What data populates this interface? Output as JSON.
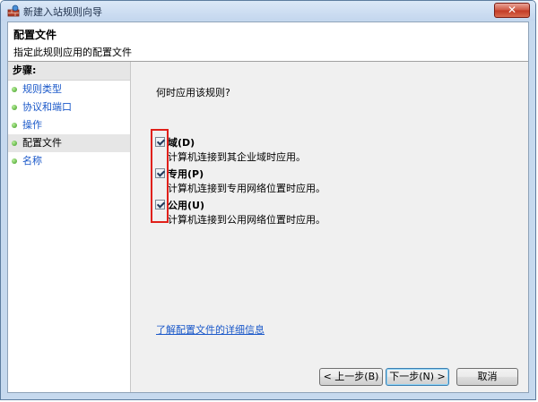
{
  "window": {
    "title": "新建入站规则向导",
    "close_label": "✕"
  },
  "header": {
    "title": "配置文件",
    "subtitle": "指定此规则应用的配置文件"
  },
  "steps": {
    "heading": "步骤:",
    "items": [
      {
        "label": "规则类型",
        "current": false
      },
      {
        "label": "协议和端口",
        "current": false
      },
      {
        "label": "操作",
        "current": false
      },
      {
        "label": "配置文件",
        "current": true
      },
      {
        "label": "名称",
        "current": false
      }
    ]
  },
  "main": {
    "question": "何时应用该规则?",
    "options": [
      {
        "label": "域(D)",
        "description": "计算机连接到其企业域时应用。",
        "checked": true
      },
      {
        "label": "专用(P)",
        "description": "计算机连接到专用网络位置时应用。",
        "checked": true
      },
      {
        "label": "公用(U)",
        "description": "计算机连接到公用网络位置时应用。",
        "checked": true
      }
    ],
    "learn_more": "了解配置文件的详细信息"
  },
  "buttons": {
    "back": "< 上一步(B)",
    "next": "下一步(N) >",
    "cancel": "取消"
  },
  "colors": {
    "link": "#1a58c9",
    "highlight": "#e0201a",
    "step_dot": "#3a9a1d"
  },
  "icons": {
    "title": "firewall-icon",
    "step": "bullet-icon"
  }
}
